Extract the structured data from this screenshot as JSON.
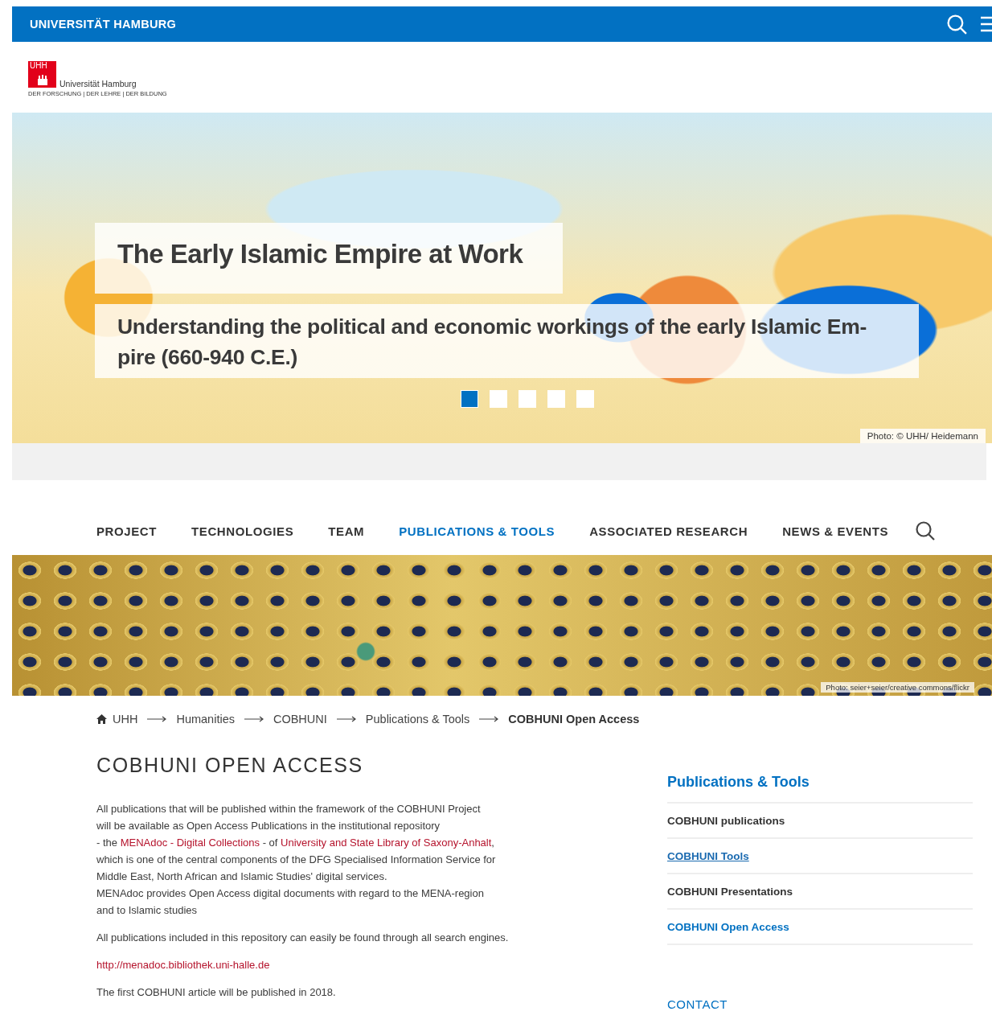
{
  "topbar": {
    "title": "UNIVERSITÄT HAMBURG"
  },
  "logo": {
    "mark": "UHH",
    "name": "Universität Hamburg",
    "motto": "DER FORSCHUNG | DER LEHRE | DER BILDUNG"
  },
  "hero": {
    "title": "The Early Islamic Empire at Work",
    "subtitle_lines": [
      "Understanding the political and economic workings of the early Islamic Em-",
      "pire (660-940 C.E.)"
    ],
    "slides": [
      {
        "selected": true
      },
      {
        "selected": false
      },
      {
        "selected": false
      },
      {
        "selected": false
      },
      {
        "selected": false
      }
    ],
    "credit": "Photo: © UHH/ Heidemann"
  },
  "nav": {
    "items": [
      {
        "label": "PROJECT",
        "selected": false
      },
      {
        "label": "TECHNOLOGIES",
        "selected": false
      },
      {
        "label": "TEAM",
        "selected": false
      },
      {
        "label": "PUBLICATIONS & TOOLS",
        "selected": true
      },
      {
        "label": "ASSOCIATED RESEARCH",
        "selected": false
      },
      {
        "label": "NEWS & EVENTS",
        "selected": false
      }
    ]
  },
  "banner": {
    "credit": "Photo: seier+seier/creative commons/flickr"
  },
  "breadcrumb": [
    {
      "label": "UHH",
      "current": false
    },
    {
      "label": "Humanities",
      "current": false
    },
    {
      "label": "COBHUNI",
      "current": false
    },
    {
      "label": "Publications & Tools",
      "current": false
    },
    {
      "label": "COBHUNI Open Access",
      "current": true
    }
  ],
  "page_title": "COBHUNI OPEN ACCESS",
  "paragraphs": [
    {
      "lines": [
        [
          {
            "kind": "text",
            "text": "All publications that will be published within the framework of the COBHUNI Project"
          }
        ],
        [
          {
            "kind": "text",
            "text": "will be available as Open Access Publications in the institutional repository"
          }
        ],
        [
          {
            "kind": "text",
            "text": "- the "
          },
          {
            "kind": "link",
            "text": "MENAdoc - Digital Collections"
          },
          {
            "kind": "text",
            "text": " - of "
          },
          {
            "kind": "link",
            "text": "University and State Library of Saxony-Anhalt"
          },
          {
            "kind": "text",
            "text": ","
          }
        ],
        [
          {
            "kind": "text",
            "text": "which is one of the central components of the DFG Specialised Information Service for"
          }
        ],
        [
          {
            "kind": "text",
            "text": "Middle East, North African and Islamic Studies' digital services."
          }
        ],
        [
          {
            "kind": "text",
            "text": "MENAdoc provides Open Access digital documents with regard to the MENA-region"
          }
        ],
        [
          {
            "kind": "text",
            "text": "and to Islamic studies"
          }
        ]
      ]
    },
    {
      "lines": [
        [
          {
            "kind": "text",
            "text": "All publications included in this repository can easily be found through all search engines."
          }
        ]
      ]
    },
    {
      "lines": [
        [
          {
            "kind": "link",
            "text": "http://menadoc.bibliothek.uni-halle.de"
          }
        ]
      ]
    },
    {
      "lines": [
        [
          {
            "kind": "text",
            "text": "The first COBHUNI article will be published in 2018."
          }
        ]
      ]
    }
  ],
  "sidebar": {
    "heading": "Publications & Tools",
    "items": [
      {
        "label": "COBHUNI publications",
        "selected": false,
        "hovered": false
      },
      {
        "label": "COBHUNI Tools",
        "selected": false,
        "hovered": true
      },
      {
        "label": "COBHUNI Presentations",
        "selected": false,
        "hovered": false
      },
      {
        "label": "COBHUNI Open Access",
        "selected": true,
        "hovered": false
      }
    ],
    "contact": "CONTACT"
  }
}
